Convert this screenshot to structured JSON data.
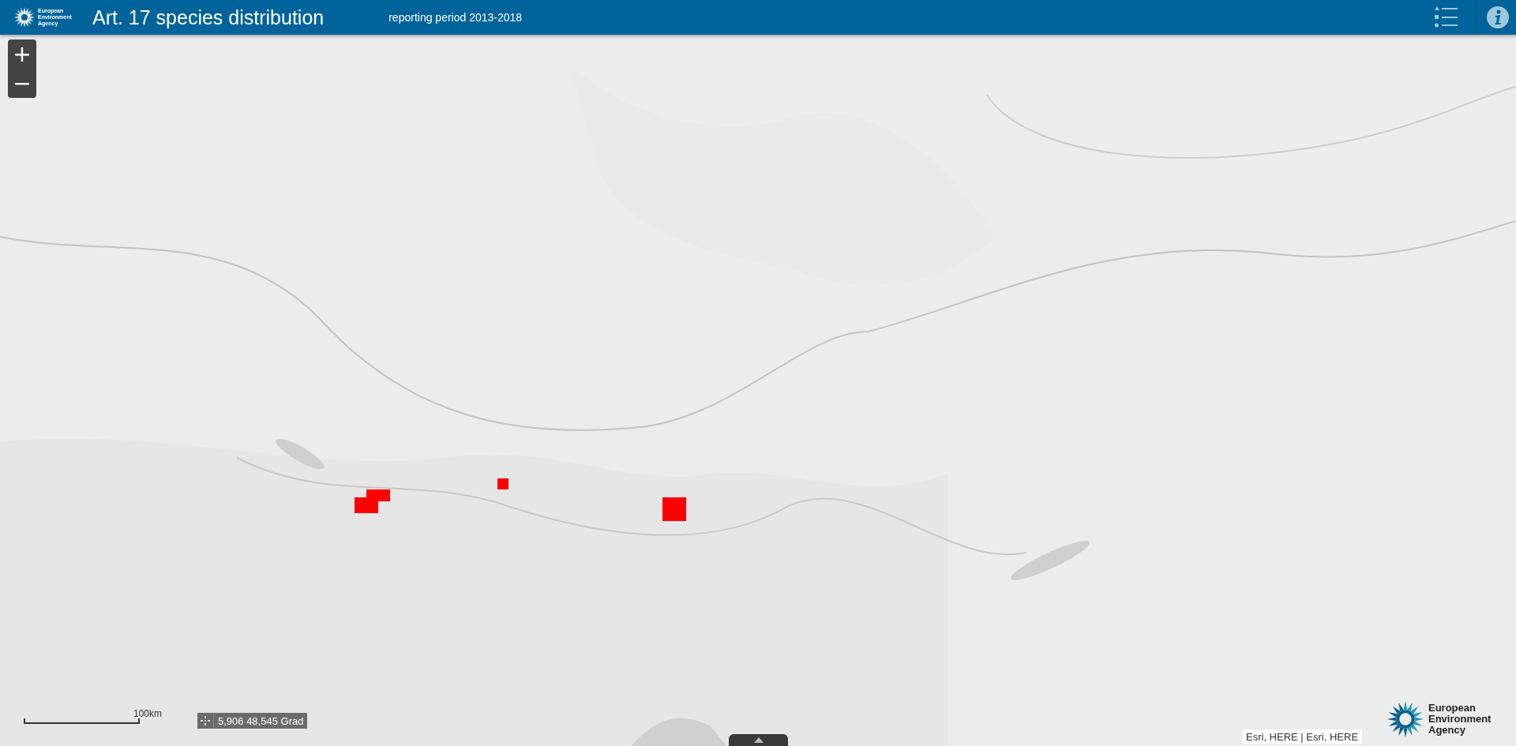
{
  "header": {
    "logo_text": "European Environment Agency",
    "title": "Art. 17 species distribution",
    "subtitle": "reporting period 2013-2018"
  },
  "zoom_controls": [
    "+",
    "−"
  ],
  "scale_bar": {
    "label": "100km"
  },
  "coordinates": {
    "text": "5,906 48,545 Grad"
  },
  "attribution": "Esri, HERE | Esri, HERE",
  "footer_logo": {
    "text": "European Environment Agency"
  }
}
